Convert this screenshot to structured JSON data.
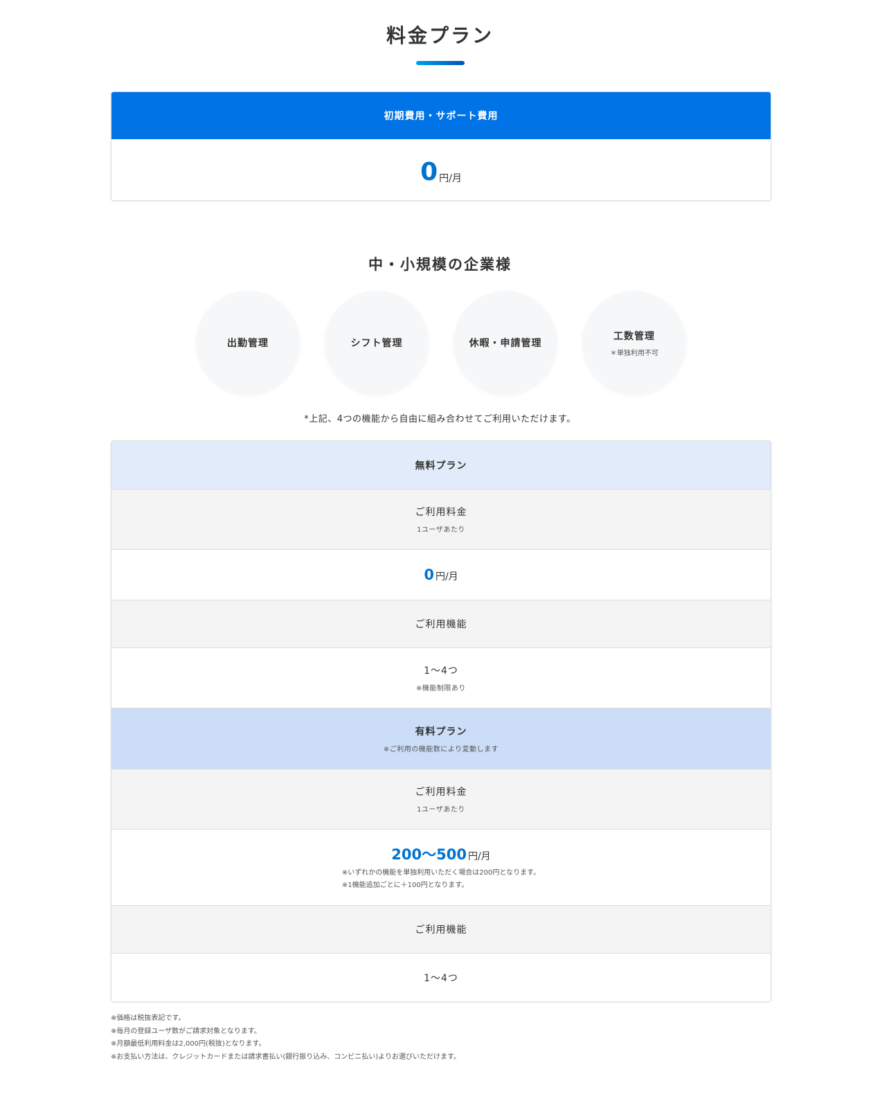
{
  "page_title": "料金プラン",
  "initial": {
    "header": "初期費用・サポート費用",
    "price": "0",
    "unit": "円/月"
  },
  "section_title": "中・小規模の企業様",
  "features": [
    {
      "label": "出勤管理",
      "note": ""
    },
    {
      "label": "シフト管理",
      "note": ""
    },
    {
      "label": "休暇・申請管理",
      "note": ""
    },
    {
      "label": "工数管理",
      "note": "＊単独利用不可"
    }
  ],
  "combo_note": "*上記、4つの機能から自由に組み合わせてご利用いただけます。",
  "free_plan": {
    "title": "無料プラン",
    "fee_label": "ご利用料金",
    "fee_sub": "1ユーザあたり",
    "price": "0",
    "unit": "円/月",
    "feature_label": "ご利用機能",
    "feature_value": "1〜4つ",
    "feature_note": "※機能制限あり"
  },
  "paid_plan": {
    "title": "有料プラン",
    "title_note": "※ご利用の機能数により変動します",
    "fee_label": "ご利用料金",
    "fee_sub": "1ユーザあたり",
    "price": "200〜500",
    "unit": "円/月",
    "price_notes": [
      "※いずれかの機能を単独利用いただく場合は200円となります。",
      "※1機能追加ごとに＋100円となります。"
    ],
    "feature_label": "ご利用機能",
    "feature_value": "1〜4つ"
  },
  "footer_notes": [
    "※価格は税抜表記です。",
    "※毎月の登録ユーザ数がご請求対象となります。",
    "※月額最低利用料金は2,000円(税抜)となります。",
    "※お支払い方法は、クレジットカードまたは請求書払い(銀行振り込み、コンビニ払い)よりお選びいただけます。"
  ],
  "colors": {
    "accent": "#0073e6",
    "price_blue": "#0073cf",
    "free_head": "#e1ebf9",
    "paid_head": "#cbddf7",
    "gray_row": "#f4f4f4"
  }
}
